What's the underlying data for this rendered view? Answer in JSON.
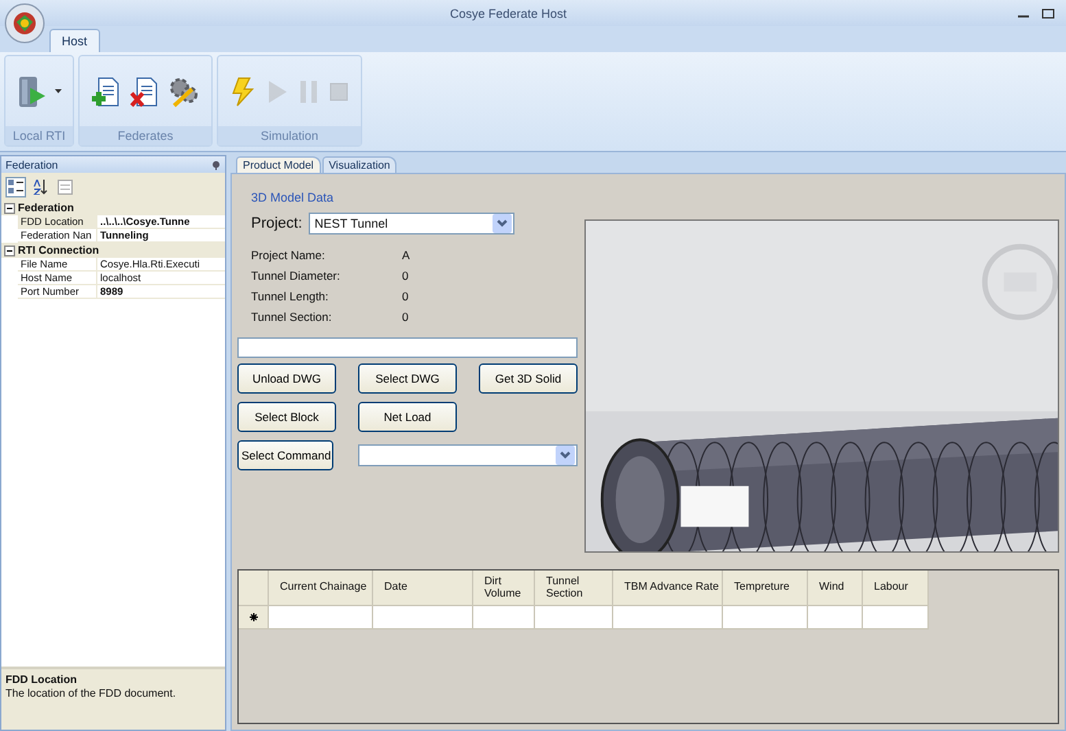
{
  "window": {
    "title": "Cosye Federate Host"
  },
  "ribbon": {
    "tabs": [
      {
        "label": "Host",
        "selected": true
      }
    ],
    "groups": [
      {
        "label": "Local RTI",
        "items": [
          {
            "kind": "rti",
            "disabled": false,
            "dropdown": true
          }
        ]
      },
      {
        "label": "Federates",
        "items": [
          {
            "kind": "add",
            "disabled": false
          },
          {
            "kind": "remove",
            "disabled": false
          },
          {
            "kind": "configure",
            "disabled": false
          }
        ]
      },
      {
        "label": "Simulation",
        "items": [
          {
            "kind": "start",
            "disabled": false
          },
          {
            "kind": "play",
            "disabled": true
          },
          {
            "kind": "pause",
            "disabled": true
          },
          {
            "kind": "stop",
            "disabled": true
          }
        ]
      }
    ]
  },
  "federation_panel": {
    "title": "Federation",
    "toolbar": [
      {
        "kind": "categorized",
        "selected": true
      },
      {
        "kind": "alphabetical",
        "selected": false
      },
      {
        "kind": "pages",
        "selected": false
      }
    ],
    "categories": [
      {
        "label": "Federation",
        "expanded": true,
        "rows": [
          {
            "name": "FDD Location",
            "value": "..\\..\\..\\Cosye.Tunne",
            "bold": true,
            "selected": true
          },
          {
            "name": "Federation Nan",
            "value": "Tunneling",
            "bold": true,
            "selected": false
          }
        ]
      },
      {
        "label": "RTI Connection",
        "expanded": true,
        "rows": [
          {
            "name": "File Name",
            "value": "Cosye.Hla.Rti.Executi",
            "bold": false,
            "selected": false
          },
          {
            "name": "Host Name",
            "value": "localhost",
            "bold": false,
            "selected": false
          },
          {
            "name": "Port Number",
            "value": "8989",
            "bold": true,
            "selected": false
          }
        ]
      }
    ],
    "description": {
      "title": "FDD Location",
      "text": "The location of the FDD document."
    }
  },
  "tabs": [
    {
      "label": "Product Model",
      "selected": true
    },
    {
      "label": "Visualization",
      "selected": false
    }
  ],
  "product_model": {
    "section_title": "3D Model Data",
    "project": {
      "label": "Project:",
      "value": "NEST Tunnel"
    },
    "info": [
      {
        "label": "Project Name:",
        "value": "A"
      },
      {
        "label": "Tunnel Diameter:",
        "value": "0"
      },
      {
        "label": "Tunnel Length:",
        "value": "0"
      },
      {
        "label": "Tunnel Section:",
        "value": "0"
      }
    ],
    "buttons": [
      [
        "Unload DWG",
        "Select DWG",
        "Get 3D Solid"
      ],
      [
        "Select Block",
        "Net Load"
      ]
    ],
    "command": {
      "label": "Select Command"
    },
    "viewport": {
      "kind": "picture"
    }
  },
  "table": {
    "columns": [
      "Current Chainage",
      "Date",
      "Dirt Volume",
      "Tunnel Section",
      "TBM Advance Rate",
      "Tempreture",
      "Wind",
      "Labour"
    ]
  }
}
